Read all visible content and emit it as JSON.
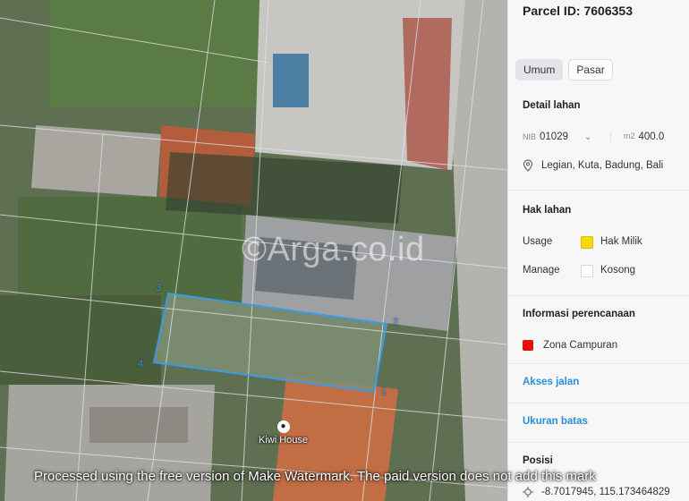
{
  "map": {
    "watermark": "©Arga.co.id",
    "poi_label": "Kiwi House",
    "poi_icon": "restaurant-icon",
    "vertex_labels": [
      "1",
      "2",
      "3",
      "4"
    ],
    "footer_watermark": "Processed using the free version of Make Watermark. The paid version does not add this mark",
    "parcel_color": "#3a9be8"
  },
  "panel": {
    "parcel_title": "Parcel ID: 7606353",
    "tabs": [
      {
        "label": "Umum",
        "active": true
      },
      {
        "label": "Pasar",
        "active": false
      }
    ],
    "detail": {
      "heading": "Detail lahan",
      "nib_prefix": "NIB",
      "nib_value": "01029",
      "area_prefix": "m2",
      "area_value": "400.0",
      "location": "Legian, Kuta, Badung, Bali"
    },
    "hak": {
      "heading": "Hak lahan",
      "usage_label": "Usage",
      "usage_value": "Hak Milik",
      "usage_color": "#f5d90a",
      "manage_label": "Manage",
      "manage_value": "Kosong",
      "manage_color": "#ffffff"
    },
    "planning": {
      "heading": "Informasi perencanaan",
      "zone": "Zona Campuran",
      "zone_color": "#e4100e"
    },
    "akses_link": "Akses jalan",
    "ukuran_link": "Ukuran batas",
    "posisi": {
      "heading": "Posisi",
      "coords": "-8.7017945, 115.173464829"
    }
  }
}
